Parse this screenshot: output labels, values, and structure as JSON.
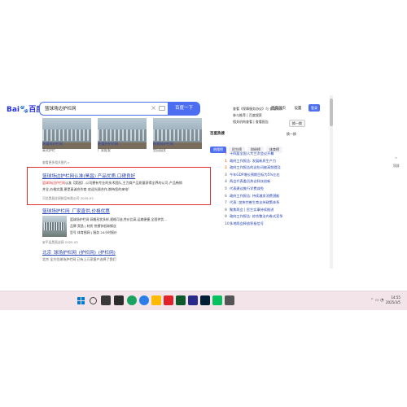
{
  "search": {
    "logo_main": "Bai",
    "logo_paw": "du",
    "logo_cn": "百度",
    "query": "篮球场边护栏网",
    "button": "百度一下"
  },
  "header": {
    "links": [
      "百度首页",
      "设置"
    ],
    "login": "登录"
  },
  "image_result": {
    "captions": [
      "热镀锌护栏网",
      "热镀锌护栏网",
      "热镀锌护栏网"
    ],
    "subs": [
      "高式护栏",
      "厂家批发",
      "宫田园艺"
    ],
    "source": "查看更多相关图片>"
  },
  "ad_result": {
    "title": "篮球场边护栏网认准(昊昌) 产品优质,口碑良好",
    "line1_hl": "篮球场边护栏网",
    "line1": "认准【昊昌】,公司拥有专业的技术团队,主力商产品质量获得全界的认可,产品畅销",
    "line2": "并全,价格实惠,更是真诚合作商 欢迎光顾合作,期待您的来电!",
    "meta": "河北昊昌丝网制品有限公司 2025-03"
  },
  "result3": {
    "title": "篮球场护栏网_厂家直供,价格优惠",
    "lines": [
      "篮球场护栏网 网格形状多样,规格可选,性价比高,运输便捷,全国供货...",
      "品牌 昊昌 | 材质 热镀锌低碳钢丝",
      "型号 体育围网 | 服务 24小时报价"
    ],
    "meta": "安平县昊昌丝网 2025-03"
  },
  "result4": {
    "title": "北京_球场护栏网_(护栏网)_(护栏网)",
    "sub": "北京 全方位球场护栏网 已有上万家客户选择了我们"
  },
  "right_col": {
    "lines": [
      "查看《保障服务协议》与 查看资质",
      "参与推荐 | 百度搜索",
      "相关机构查看 | 查看报告"
    ],
    "change_btn": "换一换",
    "hot_header": "百度热搜",
    "refresh": "换一换",
    "tabs": [
      "热搜榜",
      "民生榜",
      "财经榜",
      "体育榜"
    ],
    "hot_items": [
      "十四届全国人大三次会议开幕",
      "政府工作报告: 发展新质生产力",
      "政府工作报告的这些词被高频提及",
      "今年GDP增长预期目标为5%左右",
      "两会代表委员热议科技创新",
      "代表建议推行学费减免",
      "政府工作报告: 持续激发消费潜能",
      "代表: 加快完善生育支持政策体系",
      "聚焦两会 | 民生实事持续推进",
      "政府工作报告: 综合整治内卷式竞争",
      "多地两会释放积极信号"
    ]
  },
  "side_widget": {
    "label": "顶部"
  },
  "taskbar": {
    "time": "14:55",
    "date": "2025/3/5"
  },
  "colors": {
    "accent": "#4e6ef2",
    "link": "#2440b3",
    "highlight": "#e03030"
  }
}
